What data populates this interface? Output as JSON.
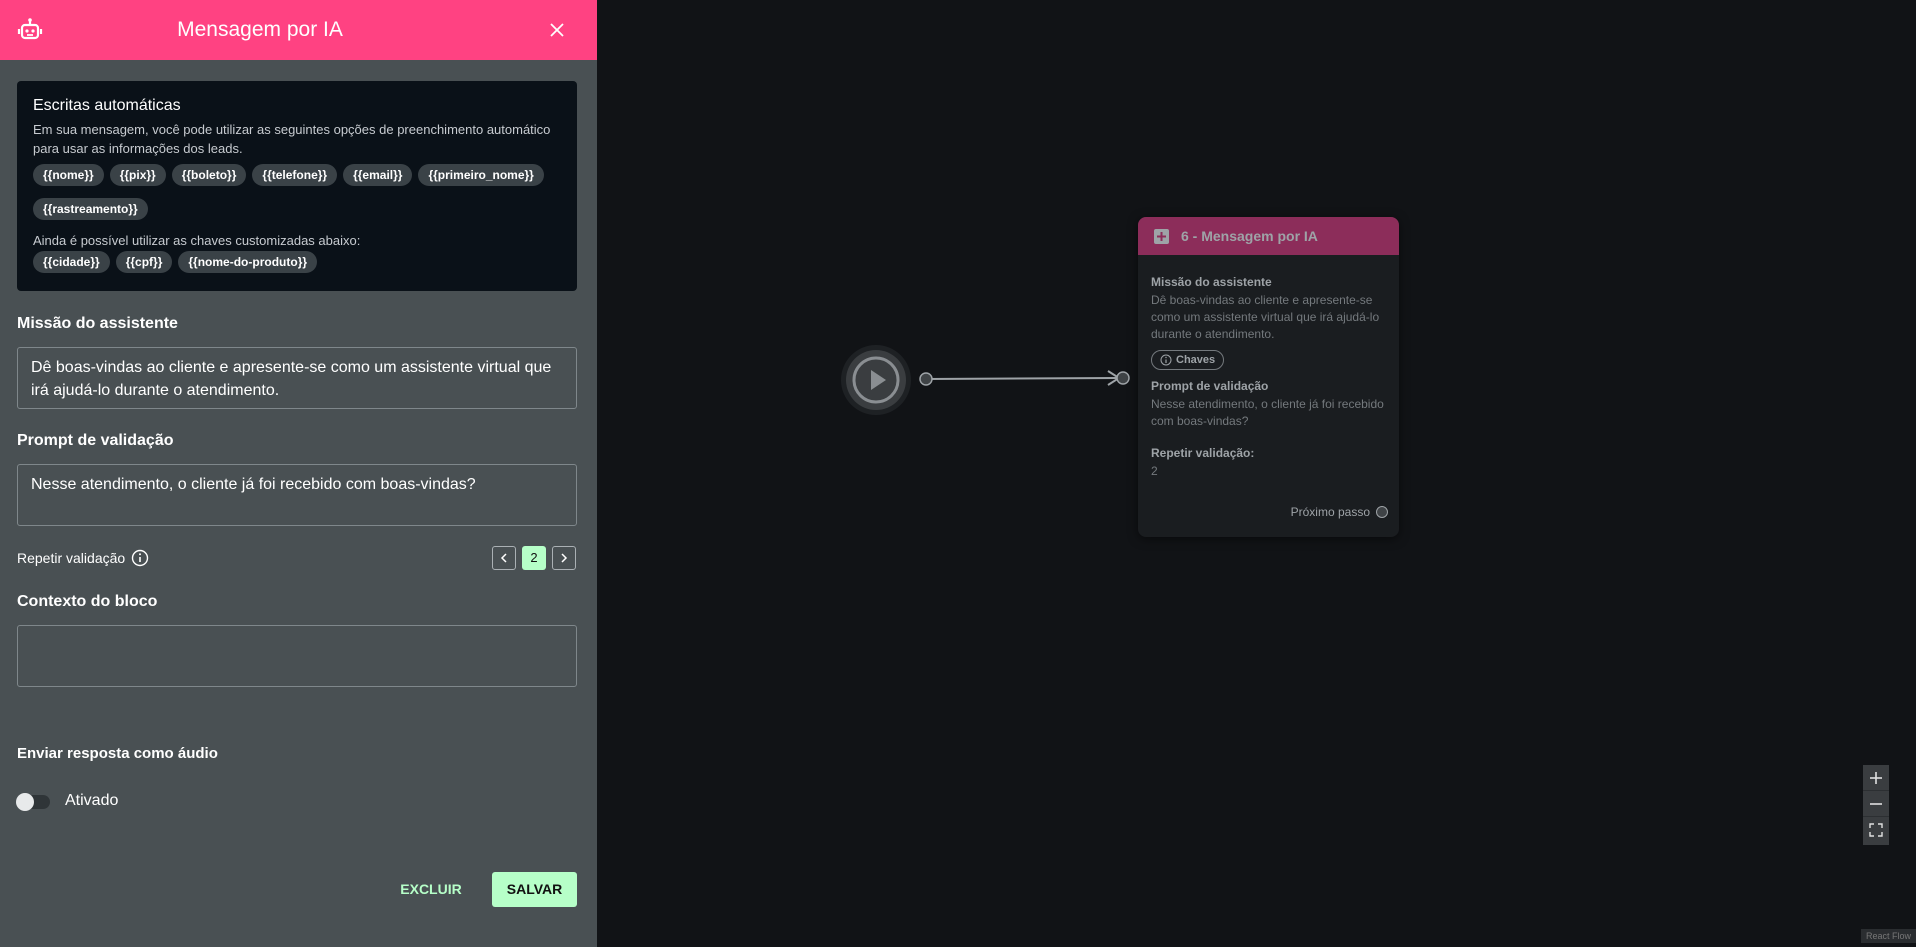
{
  "panel": {
    "title": "Mensagem por IA",
    "auto_writing": {
      "title": "Escritas automáticas",
      "description": "Em sua mensagem, você pode utilizar as seguintes opções de preenchimento automático para usar as informações dos leads.",
      "chips": [
        "{{nome}}",
        "{{pix}}",
        "{{boleto}}",
        "{{telefone}}",
        "{{email}}",
        "{{primeiro_nome}}",
        "{{rastreamento}}"
      ],
      "custom_description": "Ainda é possível utilizar as chaves customizadas abaixo:",
      "custom_chips": [
        "{{cidade}}",
        "{{cpf}}",
        "{{nome-do-produto}}"
      ]
    },
    "mission_label": "Missão do assistente",
    "mission_value": "Dê boas-vindas ao cliente e apresente-se como um assistente virtual que irá ajudá-lo durante o atendimento.",
    "prompt_label": "Prompt de validação",
    "prompt_value": "Nesse atendimento, o cliente já foi recebido com boas-vindas?",
    "repeat_label": "Repetir validação",
    "repeat_value": "2",
    "context_label": "Contexto do bloco",
    "context_value": "",
    "audio_label": "Enviar resposta como áudio",
    "toggle_label": "Ativado",
    "toggle_on": false,
    "delete_label": "EXCLUIR",
    "save_label": "SALVAR"
  },
  "canvas": {
    "node": {
      "title": "6 - Mensagem por IA",
      "mission_label": "Missão do assistente",
      "mission_text": "Dê boas-vindas ao cliente e apresente-se como um assistente virtual que irá ajudá-lo durante o atendimento.",
      "chip_label": "Chaves",
      "prompt_label": "Prompt de validação",
      "prompt_text": "Nesse atendimento, o cliente já foi recebido com boas-vindas?",
      "repeat_label": "Repetir validação:",
      "repeat_value": "2",
      "next_label": "Próximo passo"
    },
    "attribution": "React Flow"
  },
  "colors": {
    "header": "#ff4282",
    "panel_bg": "#495053",
    "accent_green": "#b6ffc8",
    "node_header": "#8c2d5a",
    "canvas_bg": "#111316"
  },
  "icons": [
    "robot-icon",
    "close-icon",
    "info-icon",
    "chevron-left-icon",
    "chevron-right-icon",
    "play-icon",
    "ai-message-icon",
    "plus-icon",
    "minus-icon",
    "fit-view-icon"
  ]
}
